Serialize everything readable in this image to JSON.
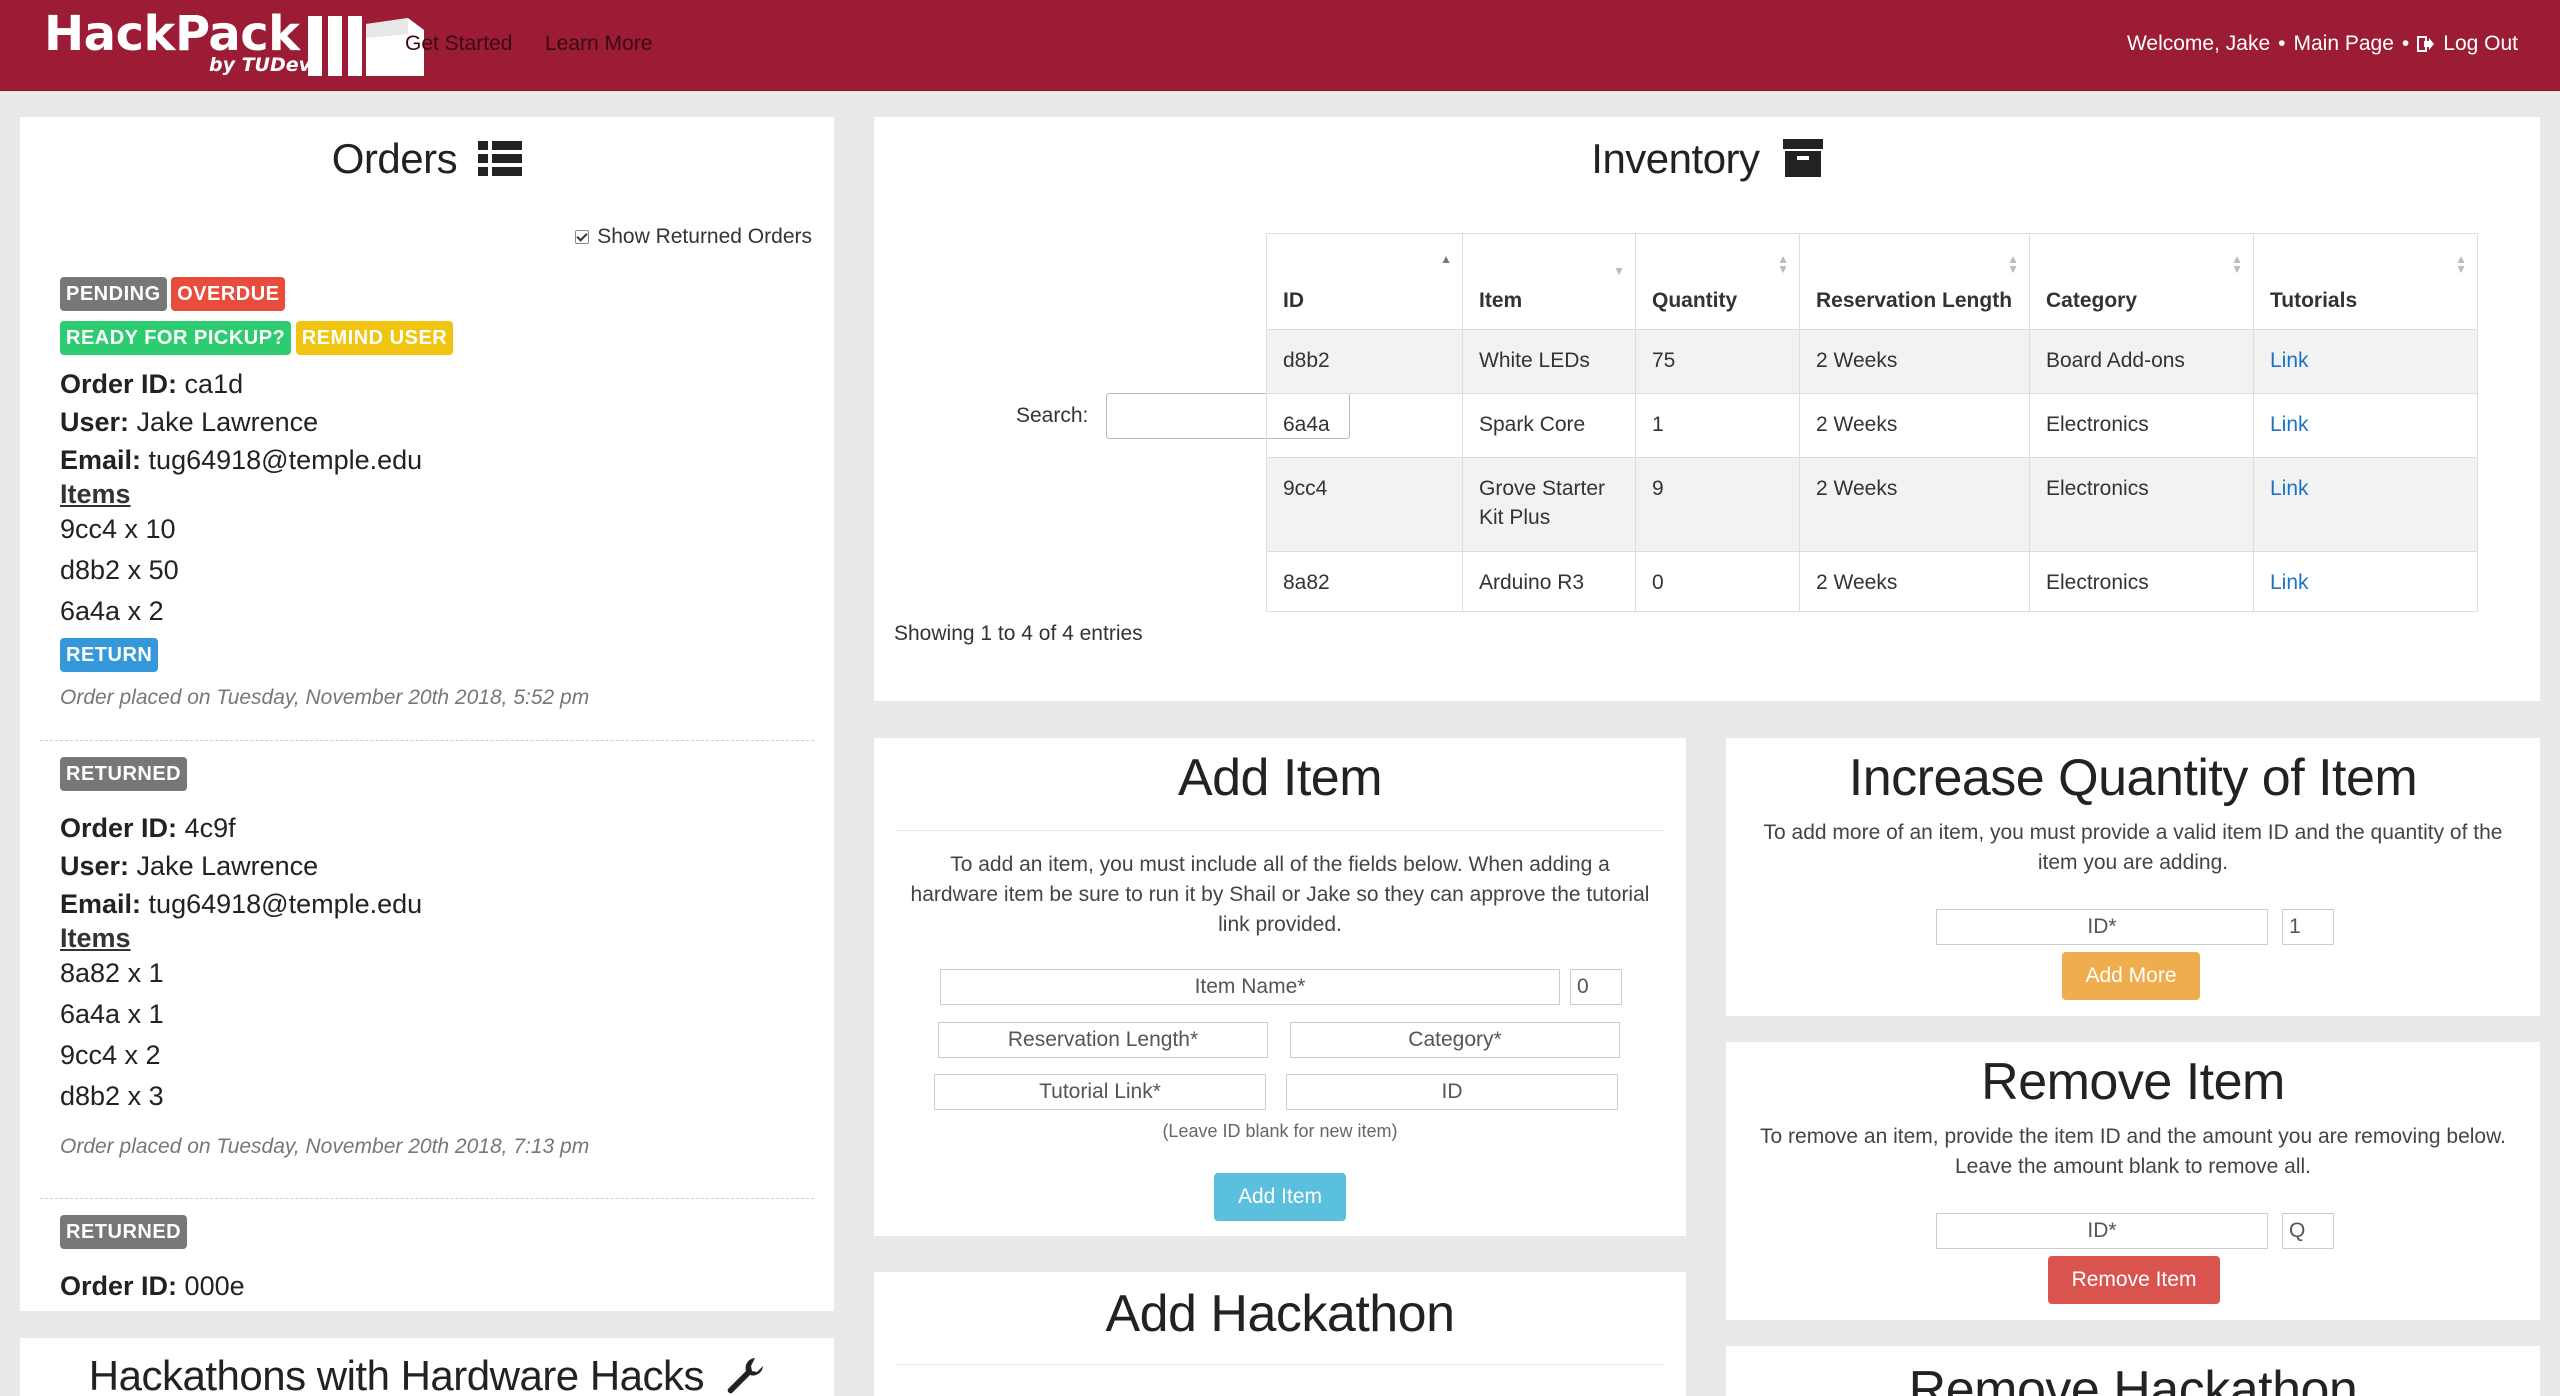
{
  "nav": {
    "brand_title": "HackPack",
    "brand_sub": "by TUDev",
    "links": [
      "Get Started",
      "Learn More"
    ],
    "welcome": "Welcome, Jake",
    "bullet": "•",
    "main_page": "Main Page",
    "logout": "Log Out"
  },
  "orders": {
    "title": "Orders",
    "show_returned_label": "Show Returned Orders",
    "show_returned_checked": true,
    "items_heading": "Items",
    "order_id_label": "Order ID:",
    "user_label": "User:",
    "email_label": "Email:",
    "list": [
      {
        "badges": [
          "PENDING",
          "OVERDUE"
        ],
        "badges2": [
          "READY FOR PICKUP?",
          "REMIND USER"
        ],
        "id": "ca1d",
        "user": "Jake Lawrence",
        "email": "tug64918@temple.edu",
        "items": [
          "9cc4 x 10",
          "d8b2 x 50",
          "6a4a x 2"
        ],
        "action": "RETURN",
        "date": "Order placed on Tuesday, November 20th 2018, 5:52 pm"
      },
      {
        "badges": [
          "RETURNED"
        ],
        "id": "4c9f",
        "user": "Jake Lawrence",
        "email": "tug64918@temple.edu",
        "items": [
          "8a82 x 1",
          "6a4a x 1",
          "9cc4 x 2",
          "d8b2 x 3"
        ],
        "date": "Order placed on Tuesday, November 20th 2018, 7:13 pm"
      },
      {
        "badges": [
          "RETURNED"
        ],
        "id": "000e"
      }
    ]
  },
  "hackathons": {
    "title": "Hackathons with Hardware Hacks"
  },
  "inventory": {
    "title": "Inventory",
    "search_label": "Search:",
    "columns": [
      "ID",
      "Item",
      "Quantity",
      "Reservation Length",
      "Category",
      "Tutorials"
    ],
    "rows": [
      [
        "d8b2",
        "White LEDs",
        "75",
        "2 Weeks",
        "Board Add-ons",
        "Link"
      ],
      [
        "6a4a",
        "Spark Core",
        "1",
        "2 Weeks",
        "Electronics",
        "Link"
      ],
      [
        "9cc4",
        "Grove Starter Kit Plus",
        "9",
        "2 Weeks",
        "Electronics",
        "Link"
      ],
      [
        "8a82",
        "Arduino R3",
        "0",
        "2 Weeks",
        "Electronics",
        "Link"
      ]
    ],
    "entries_info": "Showing 1 to 4 of 4 entries"
  },
  "add_item": {
    "title": "Add Item",
    "description": "To add an item, you must include all of the fields below. When adding a hardware item be sure to run it by Shail or Jake so they can approve the tutorial link provided.",
    "fields": {
      "item_name": "Item Name*",
      "quantity": "0",
      "reservation_length": "Reservation Length*",
      "category": "Category*",
      "tutorial_link": "Tutorial Link*",
      "id": "ID"
    },
    "hint": "(Leave ID blank for new item)",
    "button": "Add Item"
  },
  "increase_qty": {
    "title": "Increase Quantity of Item",
    "description": "To add more of an item, you must provide a valid item ID and the quantity of the item you are adding.",
    "id_placeholder": "ID*",
    "qty_value": "1",
    "button": "Add More"
  },
  "remove_item": {
    "title": "Remove Item",
    "description": "To remove an item, provide the item ID and the amount you are removing below. Leave the amount blank to remove all.",
    "id_placeholder": "ID*",
    "qty_placeholder": "Q",
    "button": "Remove Item"
  },
  "add_hackathon": {
    "title": "Add Hackathon"
  },
  "remove_hackathon": {
    "title": "Remove Hackathon"
  },
  "colors": {
    "navbar": "#9b1c34",
    "pending": "#777777",
    "overdue": "#e74c3c",
    "ready": "#2ecc71",
    "remind": "#f1c40f",
    "return": "#3498db",
    "btn_info": "#5bc0de",
    "btn_warning": "#f0ad4e",
    "btn_danger": "#d9534f"
  }
}
